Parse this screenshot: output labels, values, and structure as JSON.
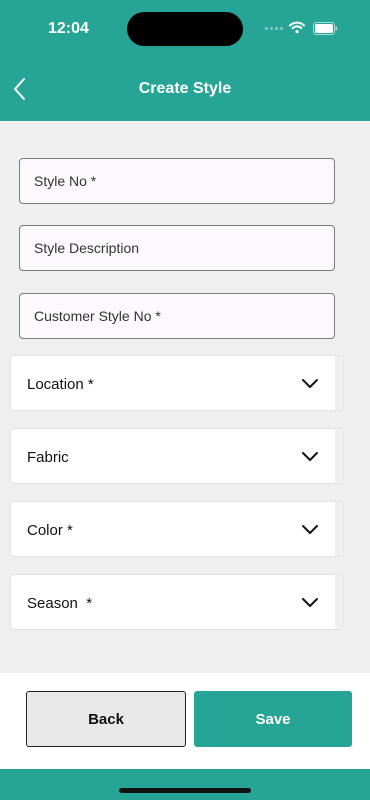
{
  "status_bar": {
    "time": "12:04"
  },
  "header": {
    "title": "Create Style"
  },
  "form": {
    "fields": [
      {
        "placeholder": "Style No *",
        "value": ""
      },
      {
        "placeholder": "Style Description",
        "value": ""
      },
      {
        "placeholder": "Customer Style No *",
        "value": ""
      }
    ],
    "dropdowns": [
      {
        "label": "Location *"
      },
      {
        "label": "Fabric"
      },
      {
        "label": "Color *"
      },
      {
        "label": "Season  *"
      }
    ]
  },
  "actions": {
    "back_label": "Back",
    "save_label": "Save"
  },
  "icons": {
    "back": "chevron-left-icon",
    "dropdown": "chevron-down-icon",
    "wifi": "wifi-icon",
    "battery": "battery-icon",
    "signal": "cellular-signal-icon"
  },
  "colors": {
    "accent": "#26a596",
    "background": "#efefef",
    "field_background": "#fdf8fb"
  }
}
